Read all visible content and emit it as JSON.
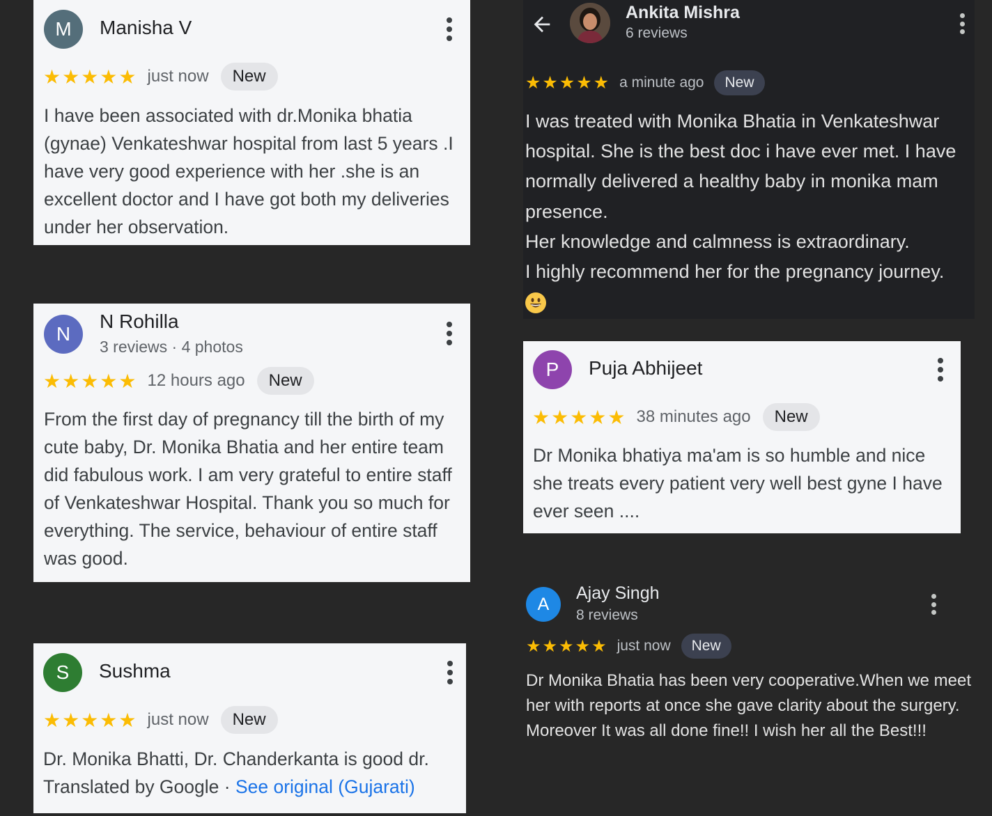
{
  "reviews": [
    {
      "avatar_letter": "M",
      "avatar_color": "#546e7a",
      "name": "Manisha V",
      "stars": "★★★★★",
      "time": "just now",
      "badge": "New",
      "text": "I have been associated with dr.Monika bhatia (gynae) Venkateshwar hospital from last 5 years .I have very good experience with her .she is an excellent doctor and I have got both my deliveries under her observation."
    },
    {
      "avatar_letter": "N",
      "avatar_color": "#5c6bc0",
      "name": "N Rohilla",
      "meta": "3 reviews · 4 photos",
      "stars": "★★★★★",
      "time": "12 hours ago",
      "badge": "New",
      "text": "From the first day of pregnancy till the birth of my cute baby, Dr. Monika Bhatia and her entire team did fabulous work. I am very grateful to entire staff of Venkateshwar Hospital. Thank you so much for everything. The service, behaviour of entire staff was good."
    },
    {
      "avatar_letter": "S",
      "avatar_color": "#2e7d32",
      "name": "Sushma",
      "stars": "★★★★★",
      "time": "just now",
      "badge": "New",
      "text": "Dr. Monika Bhatti, Dr. Chanderkanta is good dr.",
      "translated_label": "Translated by Google",
      "separator": " · ",
      "see_original": "See original (Gujarati)"
    },
    {
      "name": "Ankita Mishra",
      "meta": "6 reviews",
      "stars": "★★★★★",
      "time": "a minute ago",
      "badge": "New",
      "lines": [
        "I was treated with Monika Bhatia in Venkateshwar",
        "hospital. She is the best doc i have ever met. I have",
        "normally delivered a healthy baby in monika mam",
        "presence.",
        "Her knowledge and calmness is extraordinary.",
        "I highly recommend her for the pregnancy journey."
      ],
      "emoji": "grinning-face"
    },
    {
      "avatar_letter": "P",
      "avatar_color": "#8e44ad",
      "name": "Puja Abhijeet",
      "stars": "★★★★★",
      "time": "38 minutes ago",
      "badge": "New",
      "text": "Dr Monika bhatiya ma'am is so humble and nice she treats every patient very well best gyne I have ever seen ...."
    },
    {
      "avatar_letter": "A",
      "avatar_color": "#1e88e5",
      "name": "Ajay Singh",
      "meta": "8 reviews",
      "stars": "★★★★★",
      "time": "just now",
      "badge": "New",
      "lines": [
        "Dr Monika Bhatia has been very cooperative.When we meet her with reports at once she gave clarity about the surgery.",
        "Moreover It was all done fine!! I wish her all the Best!!!"
      ]
    }
  ],
  "colors": {
    "page_bg": "#272727",
    "light_card_bg": "#f5f6f8",
    "dark_card_bg": "#202124",
    "star": "#fbbc04",
    "link": "#1a73e8"
  },
  "icons": {
    "back": "arrow-left-icon",
    "more": "more-vert-icon"
  }
}
